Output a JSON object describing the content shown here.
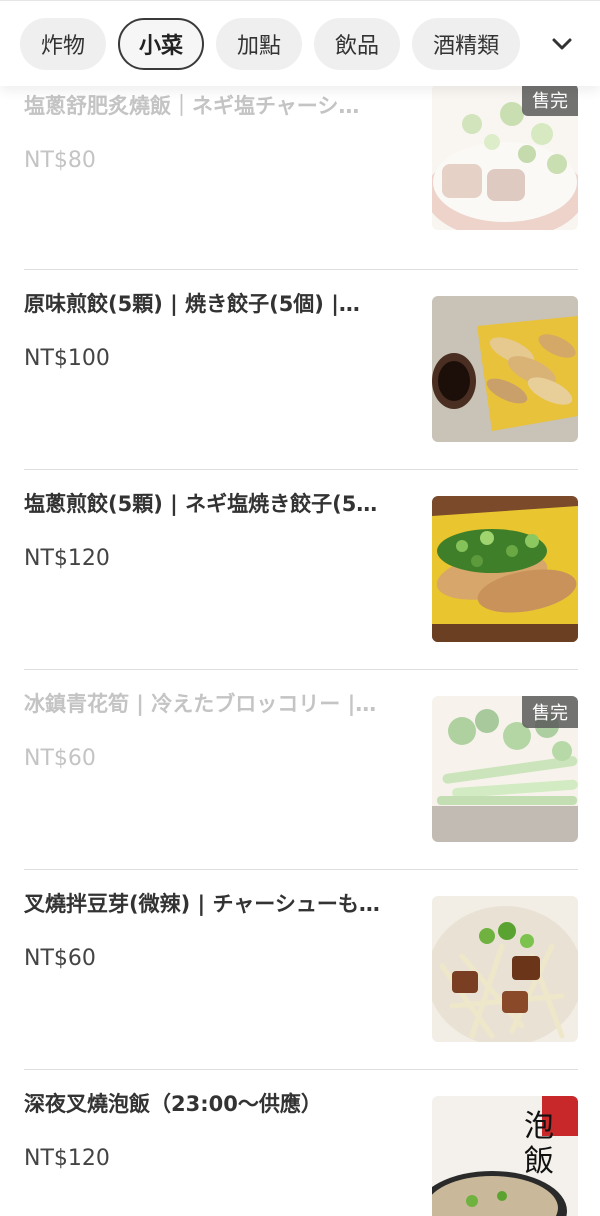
{
  "categories": [
    {
      "label": "炸物",
      "active": false
    },
    {
      "label": "小菜",
      "active": true
    },
    {
      "label": "加點",
      "active": false
    },
    {
      "label": "飲品",
      "active": false
    },
    {
      "label": "酒精類",
      "active": false
    }
  ],
  "items": [
    {
      "name": "塩蔥舒肥炙燒飯｜ネギ塩チャーシ…",
      "price": "NT$80",
      "sold_out": true,
      "badge": "售完",
      "image": "scallion-pork-rice-bowl"
    },
    {
      "name": "原味煎餃(5顆) | 焼き餃子(5個) |…",
      "price": "NT$100",
      "sold_out": false,
      "image": "pan-fried-dumplings"
    },
    {
      "name": "塩蔥煎餃(5顆) | ネギ塩焼き餃子(5…",
      "price": "NT$120",
      "sold_out": false,
      "image": "scallion-dumplings"
    },
    {
      "name": "冰鎮青花筍 | 冷えたブロッコリー |…",
      "price": "NT$60",
      "sold_out": true,
      "badge": "售完",
      "image": "chilled-broccolini"
    },
    {
      "name": "叉燒拌豆芽(微辣) | チャーシューも…",
      "price": "NT$60",
      "sold_out": false,
      "image": "chashu-bean-sprouts"
    },
    {
      "name": "深夜叉燒泡飯（23:00～供應）",
      "price": "NT$120",
      "sold_out": false,
      "image": "chashu-rice-soup"
    }
  ],
  "colors": {
    "chip_bg": "#efefef",
    "active_border": "#3a3a3a",
    "sold_out_text": "#c4c4c4",
    "badge_bg": "#5a5a5a"
  }
}
